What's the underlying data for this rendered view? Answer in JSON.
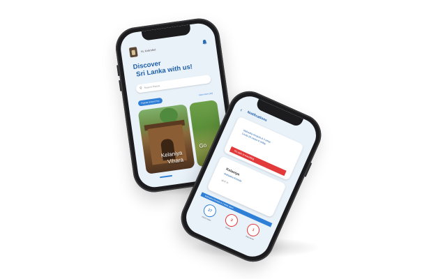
{
  "phone1": {
    "greeting": "Hi, Kalindiwi",
    "title_line1": "Discover",
    "title_line2": "Sri Lanka with us!",
    "search_placeholder": "Search Places",
    "chip_label": "Popular Around You",
    "view_more": "View more (10)",
    "card1_line1": "Kelaniya",
    "card1_line2": "Vihara",
    "card2_label": "Go"
  },
  "phone2": {
    "title": "Notifications",
    "notif1_line1": "Mahaaha Kirstola & 3 other",
    "notif1_line2": "Covid-19 cases in today",
    "notif1_banner": "It's safe to travelling",
    "notif2_title": "Kelaniya",
    "notif2_sub": "Mahaaha Kirstola",
    "notif2_extra": "18:37 hr",
    "bluebar": "Mahaaha Kirstola & 2 other alerts",
    "stats": [
      {
        "value": "27",
        "label": "Covid Cases"
      },
      {
        "value": "3",
        "label": "Deaths"
      },
      {
        "value": "1",
        "label": "Recovered"
      }
    ]
  },
  "colors": {
    "accent": "#2f7fd6",
    "title": "#1e5fa8",
    "alert": "#e23a3a"
  },
  "icons": {
    "bell": "bell-icon",
    "search": "search-icon",
    "back": "chevron-left-icon",
    "fab": "navigation-icon"
  }
}
